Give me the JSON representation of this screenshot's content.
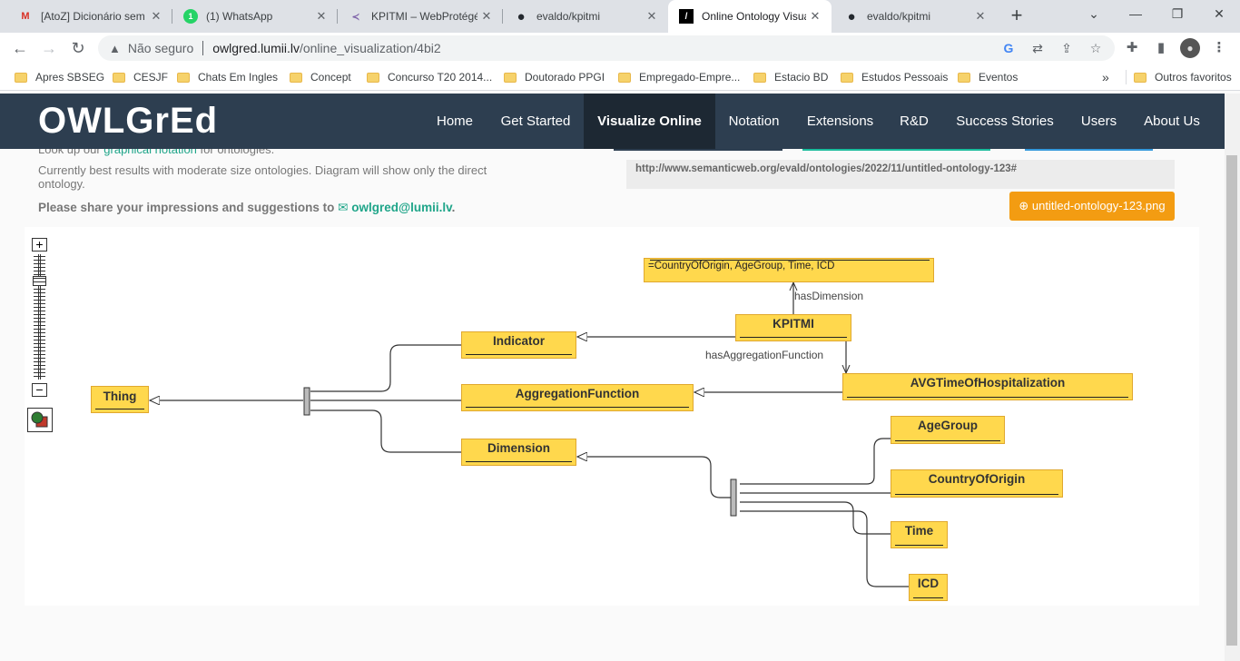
{
  "browser": {
    "tabs": [
      {
        "title": "[AtoZ] Dicionário sem",
        "icon": "gmail-icon",
        "icon_glyph": "M",
        "icon_color": "#d93025"
      },
      {
        "title": "(1) WhatsApp",
        "icon": "whatsapp-icon",
        "icon_glyph": "1",
        "icon_color": "#25d366"
      },
      {
        "title": "KPITMI – WebProtégé",
        "icon": "webprotege-icon",
        "icon_glyph": "≺",
        "icon_color": "#7b5ea7"
      },
      {
        "title": "evaldo/kpitmi",
        "icon": "github-icon",
        "icon_glyph": "●",
        "icon_color": "#24292f"
      },
      {
        "title": "Online Ontology Visua",
        "icon": "owlgred-icon",
        "icon_glyph": "/",
        "icon_color": "#000000",
        "active": true
      },
      {
        "title": "evaldo/kpitmi",
        "icon": "github-icon",
        "icon_glyph": "●",
        "icon_color": "#24292f"
      }
    ],
    "new_tab": "+",
    "window_controls": {
      "dropdown": "⌄",
      "minimize": "—",
      "restore": "❐",
      "close": "✕"
    },
    "address": {
      "security_label": "Não seguro",
      "host": "owlgred.lumii.lv",
      "path": "/online_visualization/4bi2"
    },
    "bookmarks": [
      "Apres SBSEG",
      "CESJF",
      "Chats Em Ingles",
      "Concept",
      "Concurso T20 2014...",
      "Doutorado PPGI",
      "Empregado-Empre...",
      "Estacio BD",
      "Estudos Pessoais",
      "Eventos"
    ],
    "bookmarks_more": "»",
    "other_bookmarks": "Outros favoritos"
  },
  "site": {
    "brand": "OWLGrEd",
    "nav": [
      "Home",
      "Get Started",
      "Visualize Online",
      "Notation",
      "Extensions",
      "R&D",
      "Success Stories",
      "Users",
      "About Us"
    ],
    "active_nav": "Visualize Online"
  },
  "intro": {
    "line1_pre": "Look up our ",
    "line1_link": "graphical notation",
    "line1_post": " for ontologies.",
    "line2": "Currently best results with moderate size ontologies. Diagram will show only the direct ontology.",
    "line3": "Please share your impressions and suggestions to",
    "email": "owlgred@lumii.lv",
    "period": "."
  },
  "ontology": {
    "iri": "http://www.semanticweb.org/evald/ontologies/2022/11/untitled-ontology-123#",
    "download_label": "untitled-ontology-123.png"
  },
  "zoom": {
    "plus": "+",
    "minus": "−"
  },
  "diagram": {
    "classes": {
      "thing": "Thing",
      "indicator": "Indicator",
      "aggregation": "AggregationFunction",
      "dimension": "Dimension",
      "kpitmi": "KPITMI",
      "avg": "AVGTimeOfHospitalization",
      "agegroup": "AgeGroup",
      "country": "CountryOfOrigin",
      "time": "Time",
      "icd": "ICD"
    },
    "equivalence_box": "=CountryOfOrigin, AgeGroup, Time, ICD",
    "edge_labels": {
      "has_dimension": "hasDimension",
      "has_aggregation_function": "hasAggregationFunction"
    }
  },
  "colors": {
    "navbar": "#2d3e50",
    "node_fill": "#ffd84d",
    "node_border": "#e0a82e",
    "link": "#1fa589",
    "download_button": "#f39c12"
  }
}
